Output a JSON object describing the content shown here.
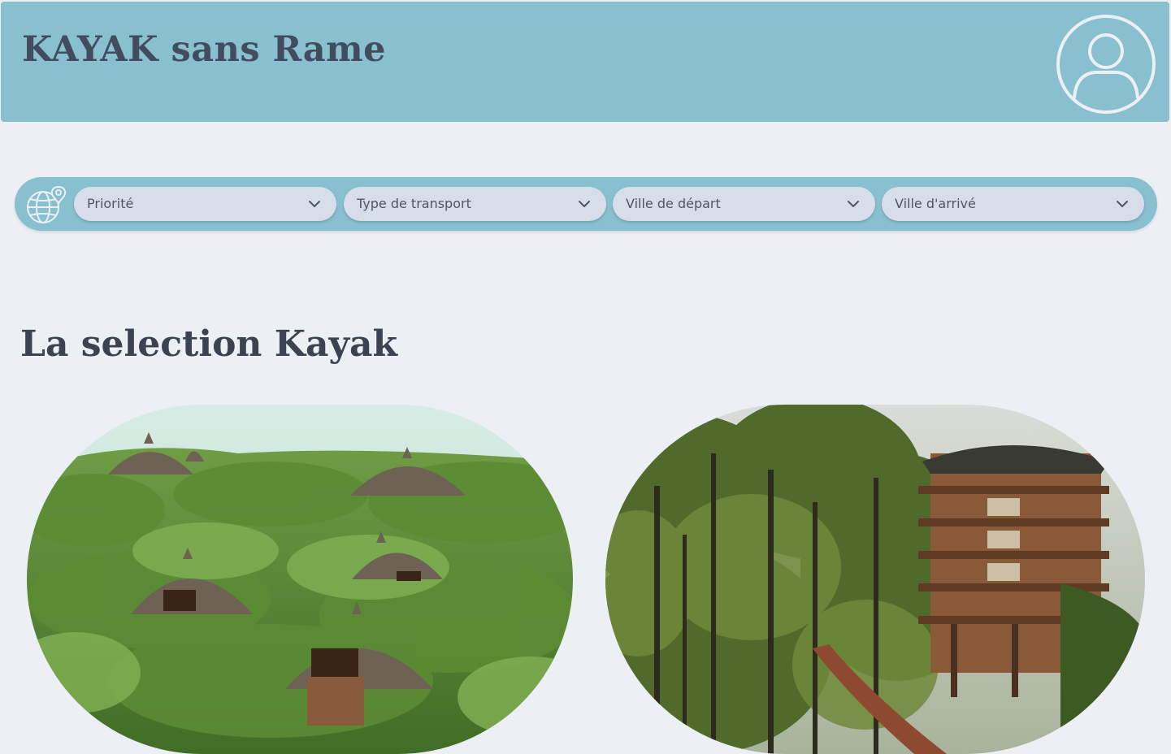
{
  "header": {
    "title": "KAYAK sans Rame",
    "icons": {
      "avatar": "user-circle-icon"
    }
  },
  "filters": {
    "icon": "globe-location-icon",
    "selects": [
      {
        "label": "Priorité",
        "icon": "chevron-down-icon"
      },
      {
        "label": "Type de transport",
        "icon": "chevron-down-icon"
      },
      {
        "label": "Ville de départ",
        "icon": "chevron-down-icon"
      },
      {
        "label": "Ville d'arrivé",
        "icon": "chevron-down-icon"
      }
    ]
  },
  "selection": {
    "title": "La selection Kayak",
    "cards": [
      {
        "image": "thatched-hut-lodges-photo"
      },
      {
        "image": "forest-treehouse-hotel-photo"
      }
    ]
  },
  "colors": {
    "background": "#eceff4",
    "header": "#88c0d0",
    "select": "#d8dee9",
    "title_text": "#434c5e"
  }
}
